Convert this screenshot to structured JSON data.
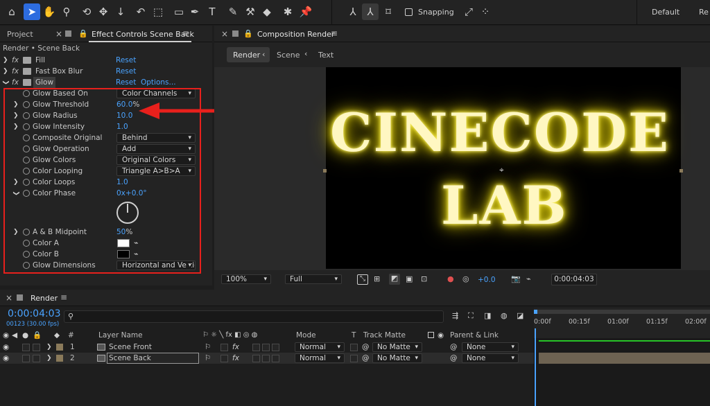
{
  "toolbar": {
    "snapping_label": "Snapping",
    "workspace_default": "Default",
    "workspace_next": "Re",
    "tools": [
      "home-icon",
      "selection-tool-icon",
      "hand-tool-icon",
      "zoom-tool-icon",
      "rotate-tool-icon",
      "anchor-point-tool-icon",
      "move-down-icon",
      "undo-orbit-icon",
      "region-icon",
      "rectangle-tool-icon",
      "pen-tool-icon",
      "text-tool-icon",
      "brush-tool-icon",
      "clone-stamp-icon",
      "eraser-icon",
      "roto-brush-icon",
      "puppet-pin-icon"
    ]
  },
  "left_panel": {
    "tab_project": "Project",
    "tab_effect_controls": "Effect Controls Scene Back",
    "breadcrumb": "Render • Scene Back",
    "effects": [
      {
        "name": "Fill",
        "reset": "Reset"
      },
      {
        "name": "Fast Box Blur",
        "reset": "Reset"
      },
      {
        "name": "Glow",
        "reset": "Reset",
        "options": "Options..."
      }
    ],
    "glow_props": {
      "based_on_label": "Glow Based On",
      "based_on_value": "Color Channels",
      "threshold_label": "Glow Threshold",
      "threshold_value": "60.0",
      "threshold_unit": "%",
      "radius_label": "Glow Radius",
      "radius_value": "10.0",
      "intensity_label": "Glow Intensity",
      "intensity_value": "1.0",
      "composite_label": "Composite Original",
      "composite_value": "Behind",
      "operation_label": "Glow Operation",
      "operation_value": "Add",
      "colors_label": "Glow Colors",
      "colors_value": "Original Colors",
      "looping_label": "Color Looping",
      "looping_value": "Triangle A>B>A",
      "loops_label": "Color Loops",
      "loops_value": "1.0",
      "phase_label": "Color Phase",
      "phase_value": "0x+0.0°",
      "midpoint_label": "A & B Midpoint",
      "midpoint_value": "50",
      "midpoint_unit": "%",
      "color_a_label": "Color A",
      "color_a": "#ffffff",
      "color_b_label": "Color B",
      "color_b": "#000000",
      "dimensions_label": "Glow Dimensions",
      "dimensions_value": "Horizontal and Vertical"
    }
  },
  "composition": {
    "tab_label": "Composition Render",
    "breadcrumb": [
      "Render",
      "Scene",
      "Text"
    ],
    "text_line1": "CINECODE",
    "text_line2": "LAB",
    "glow_color": "#f0e020",
    "zoom": "100%",
    "resolution": "Full",
    "exposure": "+0.0",
    "timecode": "0:00:04:03"
  },
  "timeline": {
    "tab_label": "Render",
    "timecode": "0:00:04:03",
    "frame_info": "00123 (30.00 fps)",
    "search_placeholder": "",
    "col_number": "#",
    "col_layer_name": "Layer Name",
    "col_mode": "Mode",
    "col_t": "T",
    "col_track_matte": "Track Matte",
    "col_parent": "Parent & Link",
    "ruler": [
      "0:00f",
      "00:15f",
      "01:00f",
      "01:15f",
      "02:00f"
    ],
    "layers": [
      {
        "num": "1",
        "name": "Scene Front",
        "mode": "Normal",
        "matte": "No Matte",
        "parent": "None"
      },
      {
        "num": "2",
        "name": "Scene Back",
        "mode": "Normal",
        "matte": "No Matte",
        "parent": "None"
      }
    ]
  },
  "annotation": {
    "arrow_color": "#e8201c",
    "box_color": "#e8201c"
  }
}
